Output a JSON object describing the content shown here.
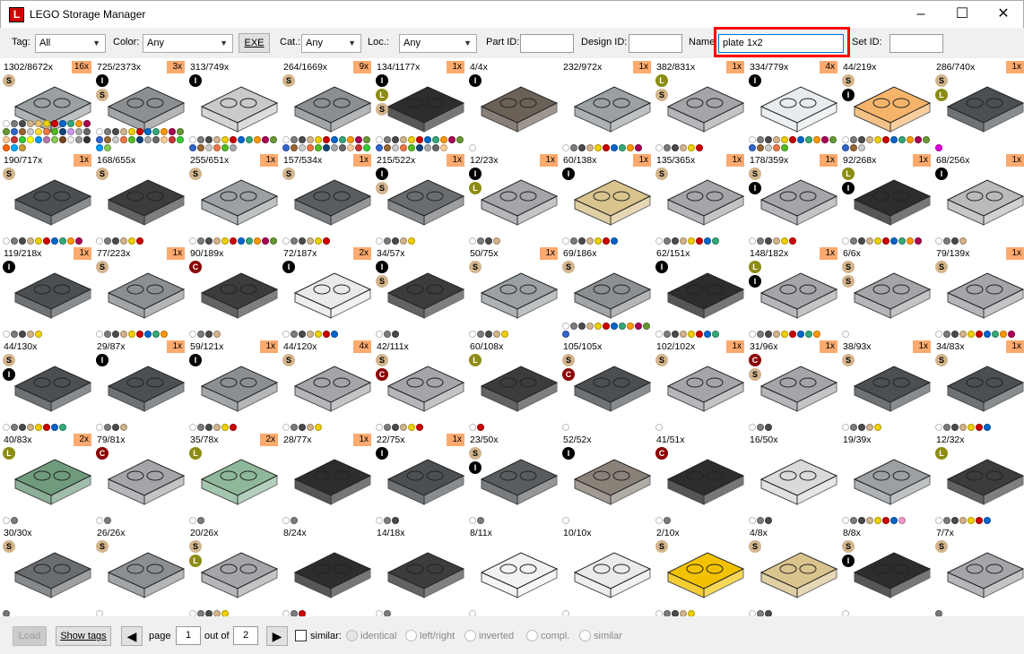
{
  "window": {
    "title": "LEGO Storage Manager",
    "icon_letter": "L"
  },
  "toolbar": {
    "tag_label": "Tag:",
    "tag_value": "All",
    "color_label": "Color:",
    "color_value": "Any",
    "exe_button": "EXE",
    "cat_label": "Cat.:",
    "cat_value": "Any",
    "loc_label": "Loc.:",
    "loc_value": "Any",
    "partid_label": "Part ID:",
    "partid_value": "",
    "designid_label": "Design ID:",
    "designid_value": "",
    "name_label": "Name",
    "name_value": "plate 1x2",
    "setid_label": "Set ID:",
    "setid_value": ""
  },
  "parts": [
    {
      "count": "1302/8672x",
      "qty": "16x",
      "badges": [
        "S"
      ],
      "color": "#9aa0a3",
      "dots": [
        "#fff",
        "#7c7c7c",
        "#4b4b4b",
        "#d2b48c",
        "#e7c16b",
        "#f0d000",
        "#c00",
        "#06c",
        "#3a7",
        "#f90",
        "#a05",
        "#693",
        "#36c",
        "#963",
        "#ccc",
        "#fd3",
        "#e74",
        "#5b2",
        "#147",
        "#c9e",
        "#aaa",
        "#666",
        "#fc9",
        "#c33",
        "#3c3",
        "#ff0",
        "#09f",
        "#b7a",
        "#8c5",
        "#742",
        "#eee",
        "#999",
        "#333",
        "#f60",
        "#0af",
        "#c93"
      ]
    },
    {
      "count": "725/2373x",
      "qty": "3x",
      "badges": [
        "I",
        "S"
      ],
      "color": "#8c8f92",
      "dots": [
        "#fff",
        "#7c7c7c",
        "#4b4b4b",
        "#d2b48c",
        "#f0d000",
        "#c00",
        "#06c",
        "#3a7",
        "#f90",
        "#a05",
        "#693",
        "#36c",
        "#963",
        "#ccc",
        "#e74",
        "#5b2",
        "#147",
        "#aaa",
        "#666",
        "#fc9",
        "#c33",
        "#3c3",
        "#09f",
        "#8c5"
      ]
    },
    {
      "count": "313/749x",
      "qty": "",
      "badges": [
        "I"
      ],
      "color": "#c8cacc",
      "dots": [
        "#fff",
        "#7c7c7c",
        "#4b4b4b",
        "#d2b48c",
        "#f0d000",
        "#c00",
        "#06c",
        "#3a7",
        "#f90",
        "#a05",
        "#693",
        "#36c",
        "#963",
        "#ccc",
        "#e74",
        "#5b2",
        "#aaa"
      ]
    },
    {
      "count": "264/1669x",
      "qty": "9x",
      "badges": [
        "S"
      ],
      "color": "#8c8f92",
      "dots": [
        "#fff",
        "#7c7c7c",
        "#4b4b4b",
        "#d2b48c",
        "#f0d000",
        "#c00",
        "#06c",
        "#3a7",
        "#f90",
        "#a05",
        "#693",
        "#36c",
        "#963",
        "#ccc",
        "#e74",
        "#5b2",
        "#147",
        "#aaa",
        "#666",
        "#fc9",
        "#c33",
        "#3c3"
      ]
    },
    {
      "count": "134/1177x",
      "qty": "1x",
      "badges": [
        "I",
        "L",
        "S"
      ],
      "color": "#2d2d2d",
      "dots": [
        "#fff",
        "#7c7c7c",
        "#4b4b4b",
        "#d2b48c",
        "#f0d000",
        "#c00",
        "#06c",
        "#3a7",
        "#f90",
        "#a05",
        "#693",
        "#36c",
        "#963",
        "#ccc",
        "#e74",
        "#5b2",
        "#147",
        "#aaa",
        "#666",
        "#fc9"
      ]
    },
    {
      "count": "4/4x",
      "qty": "",
      "badges": [
        "I"
      ],
      "color": "#6b6157",
      "dots": [
        "#fff"
      ]
    },
    {
      "count": "232/972x",
      "qty": "1x",
      "badges": [],
      "color": "#9aa0a3",
      "dots": [
        "#fff",
        "#7c7c7c",
        "#4b4b4b",
        "#d2b48c",
        "#f0d000",
        "#c00",
        "#06c",
        "#3a7",
        "#f90",
        "#a05"
      ]
    },
    {
      "count": "382/831x",
      "qty": "1x",
      "badges": [
        "L",
        "S"
      ],
      "color": "#a3a5a8",
      "dots": [
        "#fff",
        "#7c7c7c",
        "#4b4b4b",
        "#d2b48c",
        "#f0d000",
        "#c00"
      ]
    },
    {
      "count": "334/779x",
      "qty": "4x",
      "badges": [
        "I"
      ],
      "color": "#e8ecee",
      "dots": [
        "#fff",
        "#7c7c7c",
        "#4b4b4b",
        "#d2b48c",
        "#f0d000",
        "#c00",
        "#06c",
        "#3a7",
        "#f90",
        "#a05",
        "#693",
        "#36c",
        "#963",
        "#ccc",
        "#e74",
        "#5b2"
      ]
    },
    {
      "count": "44/219x",
      "qty": "",
      "badges": [
        "S",
        "I"
      ],
      "color": "#f5b46a",
      "dots": [
        "#fff",
        "#7c7c7c",
        "#4b4b4b",
        "#d2b48c",
        "#f0d000",
        "#c00",
        "#06c",
        "#3a7",
        "#f90",
        "#a05",
        "#693",
        "#36c",
        "#963",
        "#ccc"
      ]
    },
    {
      "count": "286/740x",
      "qty": "1x",
      "badges": [
        "S",
        "L"
      ],
      "color": "#4b4f52",
      "dots": [
        "#d0d"
      ]
    },
    {
      "count": "190/717x",
      "qty": "1x",
      "badges": [
        "S"
      ],
      "color": "#4b4f52",
      "dots": [
        "#fff",
        "#7c7c7c",
        "#4b4b4b",
        "#d2b48c",
        "#f0d000",
        "#c00",
        "#06c",
        "#3a7",
        "#f90",
        "#a05"
      ]
    },
    {
      "count": "168/655x",
      "qty": "",
      "badges": [
        "S"
      ],
      "color": "#3a3c3e",
      "dots": [
        "#fff",
        "#7c7c7c",
        "#4b4b4b",
        "#d2b48c",
        "#f0d000",
        "#c00"
      ]
    },
    {
      "count": "255/651x",
      "qty": "1x",
      "badges": [
        "S"
      ],
      "color": "#9aa0a3",
      "dots": [
        "#fff",
        "#7c7c7c",
        "#4b4b4b",
        "#d2b48c",
        "#f0d000",
        "#c00",
        "#06c",
        "#3a7",
        "#f90",
        "#a05",
        "#693"
      ]
    },
    {
      "count": "157/534x",
      "qty": "1x",
      "badges": [
        "S"
      ],
      "color": "#5a5d60",
      "dots": [
        "#fff",
        "#7c7c7c",
        "#4b4b4b",
        "#d2b48c",
        "#f0d000",
        "#c00"
      ]
    },
    {
      "count": "215/522x",
      "qty": "1x",
      "badges": [
        "I",
        "S"
      ],
      "color": "#6a6d70",
      "dots": [
        "#fff",
        "#7c7c7c",
        "#4b4b4b",
        "#d2b48c",
        "#f0d000"
      ]
    },
    {
      "count": "12/23x",
      "qty": "1x",
      "badges": [
        "I",
        "L"
      ],
      "color": "#a3a5a8",
      "dots": [
        "#fff",
        "#7c7c7c",
        "#4b4b4b",
        "#d2b48c"
      ]
    },
    {
      "count": "60/138x",
      "qty": "1x",
      "badges": [
        "I"
      ],
      "color": "#d9c48e",
      "dots": [
        "#fff",
        "#7c7c7c",
        "#4b4b4b",
        "#d2b48c",
        "#f0d000",
        "#c00",
        "#06c"
      ]
    },
    {
      "count": "135/365x",
      "qty": "1x",
      "badges": [
        "S"
      ],
      "color": "#a3a5a8",
      "dots": [
        "#fff",
        "#7c7c7c",
        "#4b4b4b",
        "#d2b48c",
        "#f0d000",
        "#c00",
        "#06c",
        "#3a7"
      ]
    },
    {
      "count": "178/359x",
      "qty": "1x",
      "badges": [
        "S",
        "I"
      ],
      "color": "#a3a5a8",
      "dots": [
        "#fff",
        "#7c7c7c",
        "#4b4b4b",
        "#d2b48c",
        "#f0d000",
        "#c00"
      ]
    },
    {
      "count": "92/268x",
      "qty": "1x",
      "badges": [
        "L",
        "I"
      ],
      "color": "#2d2d2d",
      "dots": [
        "#fff",
        "#7c7c7c",
        "#4b4b4b",
        "#d2b48c",
        "#f0d000",
        "#c00",
        "#06c",
        "#3a7",
        "#f90",
        "#a05"
      ]
    },
    {
      "count": "68/256x",
      "qty": "1x",
      "badges": [
        "I"
      ],
      "color": "#b8babc",
      "dots": [
        "#fff",
        "#7c7c7c",
        "#4b4b4b",
        "#d2b48c"
      ]
    },
    {
      "count": "119/218x",
      "qty": "1x",
      "badges": [
        "I"
      ],
      "color": "#4b4f52",
      "dots": [
        "#fff",
        "#7c7c7c",
        "#4b4b4b",
        "#d2b48c",
        "#f0d000"
      ]
    },
    {
      "count": "77/223x",
      "qty": "1x",
      "badges": [
        "S"
      ],
      "color": "#8c8f92",
      "dots": [
        "#fff",
        "#7c7c7c",
        "#4b4b4b",
        "#d2b48c",
        "#f0d000",
        "#c00",
        "#06c",
        "#3a7",
        "#f90"
      ]
    },
    {
      "count": "90/189x",
      "qty": "",
      "badges": [
        "C"
      ],
      "color": "#3a3c3e",
      "dots": [
        "#fff",
        "#7c7c7c",
        "#4b4b4b",
        "#d2b48c"
      ]
    },
    {
      "count": "72/187x",
      "qty": "2x",
      "badges": [
        "I"
      ],
      "color": "#e8eaec",
      "dots": [
        "#fff",
        "#7c7c7c",
        "#4b4b4b",
        "#d2b48c",
        "#f0d000",
        "#c00",
        "#06c"
      ]
    },
    {
      "count": "34/57x",
      "qty": "",
      "badges": [
        "I",
        "S"
      ],
      "color": "#3a3c3e",
      "dots": [
        "#fff",
        "#7c7c7c",
        "#4b4b4b"
      ]
    },
    {
      "count": "50/75x",
      "qty": "1x",
      "badges": [
        "S"
      ],
      "color": "#9aa0a3",
      "dots": [
        "#fff",
        "#7c7c7c",
        "#4b4b4b",
        "#d2b48c",
        "#f0d000"
      ]
    },
    {
      "count": "69/186x",
      "qty": "",
      "badges": [
        "S"
      ],
      "color": "#8c8f92",
      "dots": [
        "#fff",
        "#7c7c7c",
        "#4b4b4b",
        "#d2b48c",
        "#f0d000",
        "#c00",
        "#06c",
        "#3a7",
        "#f90",
        "#a05",
        "#693",
        "#36c"
      ]
    },
    {
      "count": "62/151x",
      "qty": "",
      "badges": [
        "I"
      ],
      "color": "#2d2d2d",
      "dots": [
        "#fff",
        "#7c7c7c",
        "#4b4b4b",
        "#d2b48c",
        "#f0d000",
        "#c00",
        "#06c",
        "#3a7"
      ]
    },
    {
      "count": "148/182x",
      "qty": "1x",
      "badges": [
        "L",
        "I"
      ],
      "color": "#a3a5a8",
      "dots": [
        "#fff",
        "#7c7c7c",
        "#4b4b4b",
        "#d2b48c",
        "#f0d000",
        "#c00",
        "#06c",
        "#3a7",
        "#f90"
      ]
    },
    {
      "count": "6/6x",
      "qty": "",
      "badges": [
        "S",
        "S"
      ],
      "color": "#a3a5a8",
      "dots": [
        "#fff"
      ]
    },
    {
      "count": "79/139x",
      "qty": "1x",
      "badges": [
        "S"
      ],
      "color": "#a3a5a8",
      "dots": [
        "#fff",
        "#7c7c7c",
        "#4b4b4b",
        "#d2b48c",
        "#f0d000",
        "#c00",
        "#06c",
        "#3a7",
        "#f90",
        "#a05"
      ]
    },
    {
      "count": "44/130x",
      "qty": "",
      "badges": [
        "S",
        "I"
      ],
      "color": "#4b4f52",
      "dots": [
        "#fff",
        "#7c7c7c",
        "#4b4b4b",
        "#d2b48c",
        "#f0d000",
        "#c00",
        "#06c",
        "#3a7"
      ]
    },
    {
      "count": "29/87x",
      "qty": "1x",
      "badges": [
        "I"
      ],
      "color": "#4b4f52",
      "dots": [
        "#fff",
        "#7c7c7c",
        "#4b4b4b",
        "#d2b48c"
      ]
    },
    {
      "count": "59/121x",
      "qty": "1x",
      "badges": [
        "I"
      ],
      "color": "#8c8f92",
      "dots": [
        "#fff",
        "#7c7c7c",
        "#4b4b4b",
        "#d2b48c",
        "#f0d000",
        "#c00"
      ]
    },
    {
      "count": "44/120x",
      "qty": "4x",
      "badges": [
        "S"
      ],
      "color": "#a3a5a8",
      "dots": [
        "#fff",
        "#7c7c7c",
        "#4b4b4b",
        "#d2b48c",
        "#f0d000"
      ]
    },
    {
      "count": "42/111x",
      "qty": "",
      "badges": [
        "S",
        "C"
      ],
      "color": "#a3a5a8",
      "dots": [
        "#fff",
        "#7c7c7c",
        "#4b4b4b",
        "#d2b48c",
        "#f0d000",
        "#c00"
      ]
    },
    {
      "count": "60/108x",
      "qty": "",
      "badges": [
        "L"
      ],
      "color": "#3a3c3e",
      "dots": [
        "#fff",
        "#c00"
      ]
    },
    {
      "count": "105/105x",
      "qty": "",
      "badges": [
        "S",
        "C"
      ],
      "color": "#4b4f52",
      "dots": [
        "#fff"
      ]
    },
    {
      "count": "102/102x",
      "qty": "1x",
      "badges": [
        "S"
      ],
      "color": "#a3a5a8",
      "dots": [
        "#fff"
      ]
    },
    {
      "count": "31/96x",
      "qty": "1x",
      "badges": [
        "C",
        "S"
      ],
      "color": "#a3a5a8",
      "dots": [
        "#fff",
        "#7c7c7c",
        "#4b4b4b"
      ]
    },
    {
      "count": "38/93x",
      "qty": "1x",
      "badges": [
        "S"
      ],
      "color": "#4b4f52",
      "dots": [
        "#fff",
        "#7c7c7c",
        "#4b4b4b",
        "#d2b48c",
        "#f0d000"
      ]
    },
    {
      "count": "34/83x",
      "qty": "1x",
      "badges": [
        "S"
      ],
      "color": "#4b4f52",
      "dots": [
        "#fff",
        "#7c7c7c",
        "#4b4b4b",
        "#d2b48c",
        "#f0d000",
        "#c00",
        "#06c"
      ]
    },
    {
      "count": "40/83x",
      "qty": "2x",
      "badges": [
        "L"
      ],
      "color": "#6f9b7c",
      "dots": [
        "#fff",
        "#7c7c7c"
      ]
    },
    {
      "count": "79/81x",
      "qty": "",
      "badges": [
        "C"
      ],
      "color": "#a3a5a8",
      "dots": [
        "#fff",
        "#7c7c7c"
      ]
    },
    {
      "count": "35/78x",
      "qty": "2x",
      "badges": [
        "L"
      ],
      "color": "#8fb89a",
      "dots": [
        "#fff",
        "#7c7c7c"
      ]
    },
    {
      "count": "28/77x",
      "qty": "1x",
      "badges": [],
      "color": "#2d2d2d",
      "dots": [
        "#fff",
        "#7c7c7c"
      ]
    },
    {
      "count": "22/75x",
      "qty": "1x",
      "badges": [
        "I"
      ],
      "color": "#4b4f52",
      "dots": [
        "#fff",
        "#7c7c7c",
        "#4b4b4b"
      ]
    },
    {
      "count": "23/50x",
      "qty": "",
      "badges": [
        "S",
        "I"
      ],
      "color": "#5a5d60",
      "dots": [
        "#fff",
        "#7c7c7c"
      ]
    },
    {
      "count": "52/52x",
      "qty": "",
      "badges": [
        "I"
      ],
      "color": "#8a8178",
      "dots": [
        "#fff"
      ]
    },
    {
      "count": "41/51x",
      "qty": "",
      "badges": [
        "C"
      ],
      "color": "#2d2d2d",
      "dots": [
        "#fff",
        "#7c7c7c"
      ]
    },
    {
      "count": "16/50x",
      "qty": "",
      "badges": [],
      "color": "#d8dadc",
      "dots": [
        "#fff",
        "#7c7c7c",
        "#4b4b4b"
      ]
    },
    {
      "count": "19/39x",
      "qty": "",
      "badges": [],
      "color": "#9aa0a3",
      "dots": [
        "#fff",
        "#7c7c7c",
        "#4b4b4b",
        "#d2b48c",
        "#f0d000",
        "#c00",
        "#06c",
        "#f9c"
      ]
    },
    {
      "count": "12/32x",
      "qty": "",
      "badges": [
        "L"
      ],
      "color": "#3a3c3e",
      "dots": [
        "#fff",
        "#7c7c7c",
        "#4b4b4b",
        "#d2b48c",
        "#f0d000",
        "#c00",
        "#06c"
      ]
    },
    {
      "count": "30/30x",
      "qty": "",
      "badges": [
        "S"
      ],
      "color": "#6a6d70",
      "dots": [
        "#777"
      ]
    },
    {
      "count": "26/26x",
      "qty": "",
      "badges": [
        "S"
      ],
      "color": "#8c8f92",
      "dots": [
        "#fff"
      ]
    },
    {
      "count": "20/26x",
      "qty": "",
      "badges": [
        "S",
        "L"
      ],
      "color": "#a3a5a8",
      "dots": [
        "#fff",
        "#7c7c7c",
        "#4b4b4b",
        "#d2b48c",
        "#f0d000"
      ]
    },
    {
      "count": "8/24x",
      "qty": "",
      "badges": [],
      "color": "#2d2d2d",
      "dots": [
        "#fff",
        "#7c7c7c",
        "#c00"
      ]
    },
    {
      "count": "14/18x",
      "qty": "",
      "badges": [],
      "color": "#3a3c3e",
      "dots": [
        "#fff",
        "#7c7c7c"
      ]
    },
    {
      "count": "8/11x",
      "qty": "",
      "badges": [],
      "color": "#f0f2f4",
      "dots": [
        "#fff"
      ]
    },
    {
      "count": "10/10x",
      "qty": "",
      "badges": [],
      "color": "#e8eaec",
      "dots": [
        "#fff"
      ]
    },
    {
      "count": "2/10x",
      "qty": "",
      "badges": [
        "S"
      ],
      "color": "#f2c200",
      "dots": [
        "#fff",
        "#7c7c7c",
        "#4b4b4b",
        "#d2b48c",
        "#f0d000"
      ]
    },
    {
      "count": "4/8x",
      "qty": "",
      "badges": [
        "S"
      ],
      "color": "#d9c48e",
      "dots": [
        "#fff",
        "#7c7c7c",
        "#4b4b4b"
      ]
    },
    {
      "count": "8/8x",
      "qty": "",
      "badges": [
        "S",
        "I"
      ],
      "color": "#2d2d2d",
      "dots": [
        "#fff"
      ]
    },
    {
      "count": "7/7x",
      "qty": "",
      "badges": [
        "S"
      ],
      "color": "#a3a5a8",
      "dots": [
        "#777"
      ]
    }
  ],
  "statusbar": {
    "load_button": "Load",
    "show_tags_button": "Show tags",
    "page_label": "page",
    "page_value": "1",
    "out_of_label": "out of",
    "total_pages": "2",
    "similar_label": "similar:",
    "options": [
      "identical",
      "left/right",
      "inverted",
      "compl.",
      "similar"
    ]
  }
}
